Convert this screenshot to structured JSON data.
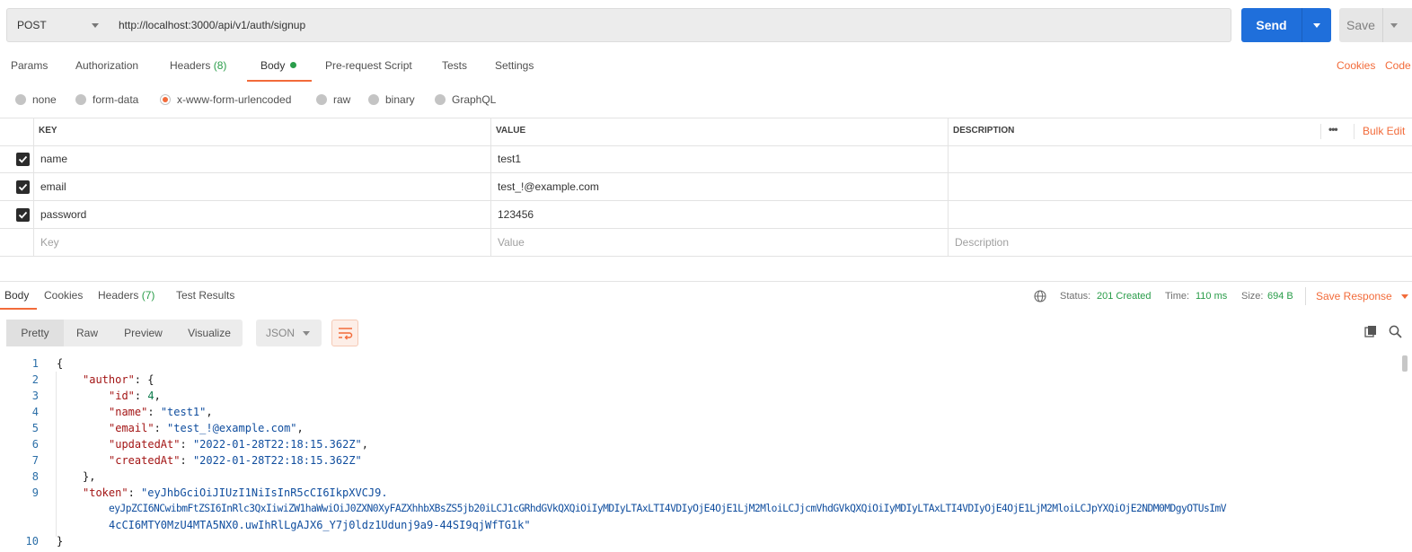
{
  "request": {
    "method": "POST",
    "url": "http://localhost:3000/api/v1/auth/signup",
    "send_label": "Send",
    "save_label": "Save"
  },
  "request_tabs": {
    "params": "Params",
    "authorization": "Authorization",
    "headers": "Headers",
    "headers_count": "(8)",
    "body": "Body",
    "pre_request": "Pre-request Script",
    "tests": "Tests",
    "settings": "Settings",
    "cookies_link": "Cookies",
    "code_link": "Code"
  },
  "body_types": {
    "none": "none",
    "form_data": "form-data",
    "urlencoded": "x-www-form-urlencoded",
    "raw": "raw",
    "binary": "binary",
    "graphql": "GraphQL",
    "selected": "x-www-form-urlencoded"
  },
  "table": {
    "headers": {
      "key": "KEY",
      "value": "VALUE",
      "description": "DESCRIPTION"
    },
    "more": "•••",
    "bulk_edit": "Bulk Edit",
    "rows": [
      {
        "key": "name",
        "value": "test1",
        "checked": true
      },
      {
        "key": "email",
        "value": "test_!@example.com",
        "checked": true
      },
      {
        "key": "password",
        "value": "123456",
        "checked": true
      }
    ],
    "placeholders": {
      "key": "Key",
      "value": "Value",
      "description": "Description"
    }
  },
  "response": {
    "tabs": {
      "body": "Body",
      "cookies": "Cookies",
      "headers": "Headers",
      "headers_count": "(7)",
      "test_results": "Test Results"
    },
    "status_label": "Status:",
    "status_value": "201 Created",
    "time_label": "Time:",
    "time_value": "110 ms",
    "size_label": "Size:",
    "size_value": "694 B",
    "save_response": "Save Response",
    "views": {
      "pretty": "Pretty",
      "raw": "Raw",
      "preview": "Preview",
      "visualize": "Visualize"
    },
    "format": "JSON",
    "code": {
      "line_numbers": [
        "1",
        "2",
        "3",
        "4",
        "5",
        "6",
        "7",
        "8",
        "9",
        "10"
      ],
      "l1": "{",
      "author_key": "\"author\"",
      "id_key": "\"id\"",
      "id_val": "4",
      "name_key": "\"name\"",
      "name_val": "\"test1\"",
      "email_key": "\"email\"",
      "email_val": "\"test_!@example.com\"",
      "updated_key": "\"updatedAt\"",
      "updated_val": "\"2022-01-28T22:18:15.362Z\"",
      "created_key": "\"createdAt\"",
      "created_val": "\"2022-01-28T22:18:15.362Z\"",
      "l8": "},",
      "token_key": "\"token\"",
      "token_line1": "\"eyJhbGciOiJIUzI1NiIsInR5cCI6IkpXVCJ9.",
      "token_line2": "eyJpZCI6NCwibmFtZSI6InRlc3QxIiwiZW1haWwiOiJ0ZXN0XyFAZXhhbXBsZS5jb20iLCJ1cGRhdGVkQXQiOiIyMDIyLTAxLTI4VDIyOjE4OjE1LjM2MloiLCJjcmVhdGVkQXQiOiIyMDIyLTAxLTI4VDIyOjE4OjE1LjM2MloiLCJpYXQiOjE2NDM0MDgyOTUsImV",
      "token_line3": "4cCI6MTY0MzU4MTA5NX0.uwIhRlLgAJX6_Y7j0ldz1Udunj9a9-44SI9qjWfTG1k\"",
      "l10": "}"
    }
  },
  "colors": {
    "accent": "#f26b3a",
    "send_blue": "#1f6fdb",
    "status_green": "#2a9d4a"
  }
}
